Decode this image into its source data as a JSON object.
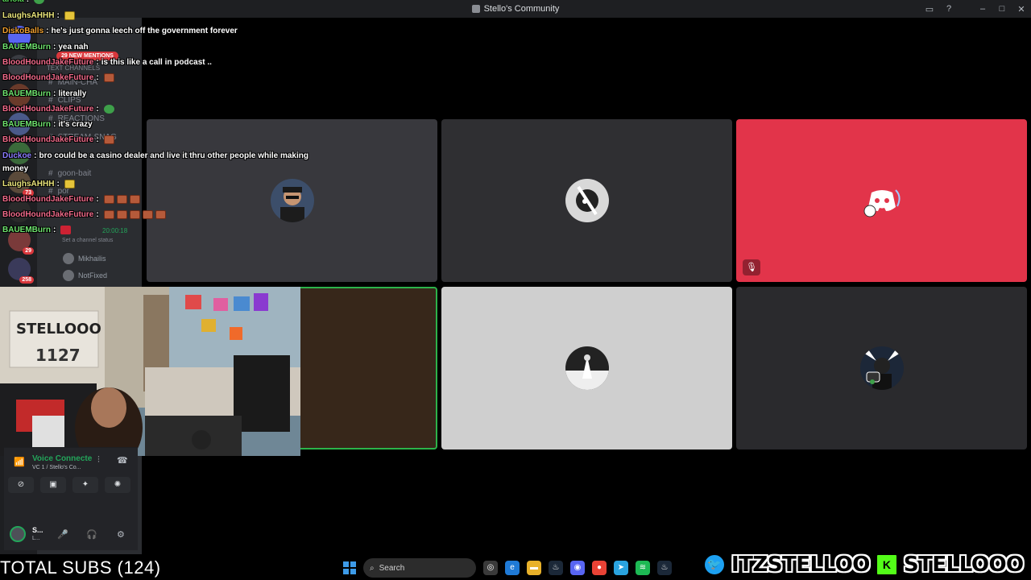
{
  "window": {
    "title": "Stello's Community"
  },
  "sidebar": {
    "mentions_pill": "29 NEW MENTIONS",
    "guild_badges": [
      "29",
      "73",
      "258"
    ],
    "text_channels_header": "TEXT CHANNELS",
    "channels": [
      "MAIN-CHA",
      "CLIPS",
      "REACTIONS",
      "STREAM-SNAG",
      "goon-bait",
      "por"
    ],
    "voice_timer": "20:00:18",
    "channel_status": "Set a channel status",
    "voice_users": [
      "Mikhailis",
      "NotFixed"
    ],
    "voice_panel": {
      "status": "Voice Connecte",
      "sub": "VC 1 / Stello's Co..."
    },
    "user": {
      "name": "S...",
      "status": "L..."
    }
  },
  "chat": [
    {
      "user": "arlola",
      "color": "#5ad65a",
      "text": "",
      "emotes": [
        "grn"
      ]
    },
    {
      "user": "LaughsAHHH",
      "color": "#e8e37a",
      "text": "",
      "emotes": [
        "yel"
      ]
    },
    {
      "user": "DiskoBalls",
      "color": "#f0a030",
      "text": "he's just gonna leech off the government forever",
      "emotes": []
    },
    {
      "user": "BAUEMBurn",
      "color": "#6ee26e",
      "text": "yea nah",
      "emotes": []
    },
    {
      "user": "BloodHoundJakeFuture",
      "color": "#f06a8a",
      "text": "is this like a call in podcast ..",
      "emotes": []
    },
    {
      "user": "BloodHoundJakeFuture",
      "color": "#f06a8a",
      "text": "",
      "emotes": [
        "brick"
      ]
    },
    {
      "user": "BAUEMBurn",
      "color": "#6ee26e",
      "text": "literally",
      "emotes": []
    },
    {
      "user": "BloodHoundJakeFuture",
      "color": "#f06a8a",
      "text": "",
      "emotes": [
        "grn"
      ]
    },
    {
      "user": "BAUEMBurn",
      "color": "#6ee26e",
      "text": "it's crazy",
      "emotes": []
    },
    {
      "user": "BloodHoundJakeFuture",
      "color": "#f06a8a",
      "text": "",
      "emotes": [
        "brick"
      ]
    },
    {
      "user": "Duckoe",
      "color": "#8b7dff",
      "text": "bro could be a casino dealer and live it thru other people while making",
      "emotes": []
    },
    {
      "user": "",
      "color": "#ffffff",
      "text": "money",
      "emotes": []
    },
    {
      "user": "LaughsAHHH",
      "color": "#e8e37a",
      "text": "",
      "emotes": [
        "yel"
      ]
    },
    {
      "user": "BloodHoundJakeFuture",
      "color": "#f06a8a",
      "text": "",
      "emotes": [
        "brick",
        "brick",
        "brick"
      ]
    },
    {
      "user": "BloodHoundJakeFuture",
      "color": "#f06a8a",
      "text": "",
      "emotes": [
        "brick",
        "brick",
        "brick",
        "brick",
        "brick"
      ]
    },
    {
      "user": "BAUEMBurn",
      "color": "#6ee26e",
      "text": "",
      "emotes": [
        "red"
      ]
    }
  ],
  "overlay": {
    "total_subs": "TOTAL SUBS (124)",
    "twitter_handle": "ITZSTELLOO",
    "kick_handle": "STELLOOO"
  },
  "taskbar": {
    "search_placeholder": "Search"
  },
  "colors": {
    "tile_red": "#e2344a",
    "speaking_border": "#2cb34a",
    "discord_green": "#23a55a"
  }
}
